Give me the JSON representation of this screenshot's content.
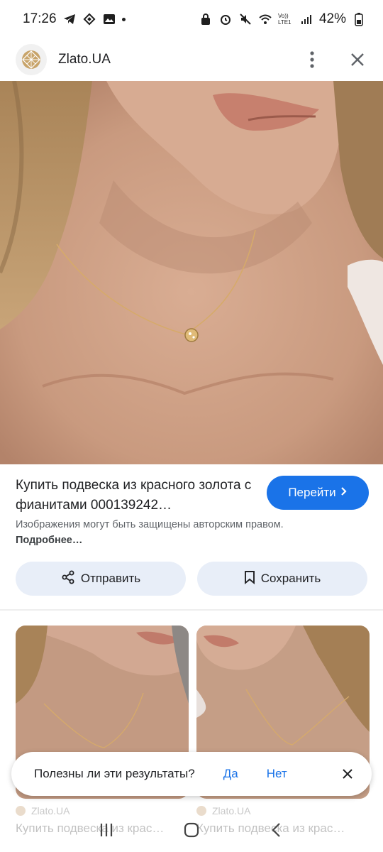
{
  "status_bar": {
    "time": "17:26",
    "battery": "42%",
    "network": "Vo)) LTE1"
  },
  "header": {
    "site_name": "Zlato.UA",
    "menu_icon": "more-vert-icon",
    "close_icon": "close-icon"
  },
  "result": {
    "title": "Купить подвеска из красного золота с фианитами 000139242…",
    "go_label": "Перейти",
    "copyright_text": "Изображения могут быть защищены авторским правом.",
    "more_link": "Подробнее…",
    "share_label": "Отправить",
    "save_label": "Сохранить"
  },
  "related": [
    {
      "source": "Zlato.UA",
      "title": "Купить подвеска из крас…"
    },
    {
      "source": "Zlato.UA",
      "title": "Купить подвеска из крас…"
    }
  ],
  "feedback": {
    "question": "Полезны ли эти результаты?",
    "yes": "Да",
    "no": "Нет"
  },
  "colors": {
    "accent": "#1a73e8",
    "chip_bg": "#e8eef8"
  }
}
